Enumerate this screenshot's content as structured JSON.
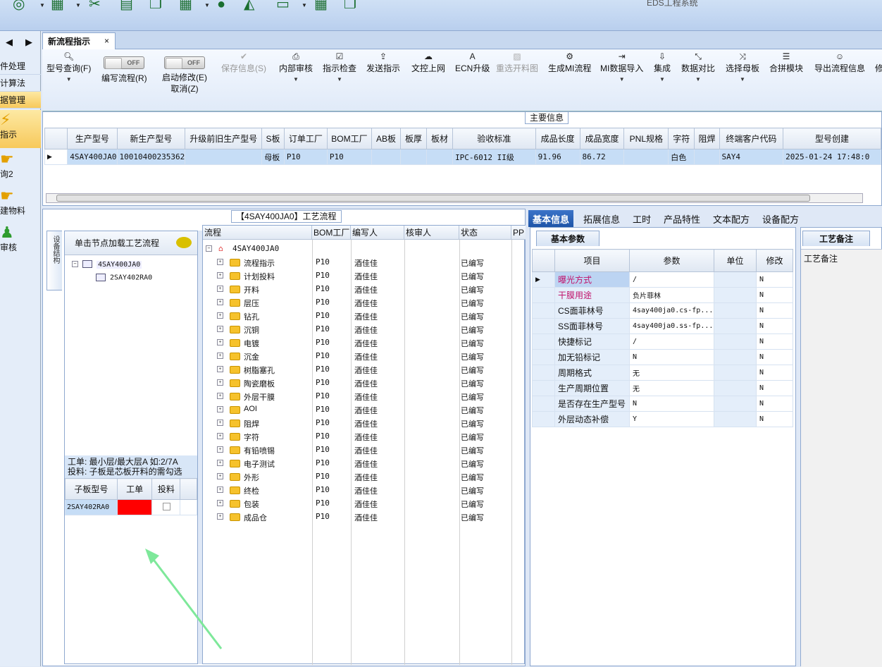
{
  "system_title": "EDS工程系统",
  "nav": {
    "items": [
      "件处理",
      "计算法",
      "据管理"
    ],
    "big_items": [
      "指示",
      "询2",
      "建物料",
      "审核"
    ]
  },
  "tab": {
    "label": "新流程指示",
    "close": "×"
  },
  "toolbar": {
    "items": [
      {
        "label": "型号查询(F)",
        "icon": "search-icon"
      },
      {
        "label": "编写流程(R)",
        "switch": "OFF"
      },
      {
        "label": "启动修改(E)",
        "label2": "取消(Z)",
        "switch": "OFF"
      },
      {
        "label": "保存信息(S)",
        "icon": "check-icon"
      },
      {
        "label": "内部审核",
        "icon": "printer-icon"
      },
      {
        "label": "指示检查",
        "icon": "checkbox-icon"
      },
      {
        "label": "发送指示",
        "icon": "upload-icon"
      },
      {
        "label": "文控上网",
        "icon": "cloud-upload-icon"
      },
      {
        "label": "ECN升级",
        "icon": "font-icon"
      },
      {
        "label": "重选开料图",
        "icon": "picture-icon"
      },
      {
        "label": "生成MI流程",
        "icon": "gears-icon"
      },
      {
        "label": "MI数据导入",
        "icon": "sign-in-icon"
      },
      {
        "label": "集成",
        "icon": "download-icon"
      },
      {
        "label": "数据对比",
        "icon": "compress-icon"
      },
      {
        "label": "选择母板",
        "icon": "shuffle-icon"
      },
      {
        "label": "合拼模块",
        "icon": "list-icon"
      },
      {
        "label": "导出流程信息",
        "icon": "smile-icon"
      },
      {
        "label": "修",
        "icon": ""
      }
    ]
  },
  "main_info": {
    "title": "主要信息",
    "columns": [
      "生产型号",
      "新生产型号",
      "升级前旧生产型号",
      "S板",
      "订单工厂",
      "BOM工厂",
      "AB板",
      "板厚",
      "板材",
      "验收标准",
      "成品长度",
      "成品宽度",
      "PNL规格",
      "字符",
      "阻焊",
      "终端客户代码",
      "型号创建"
    ],
    "row": [
      "4SAY400JA0",
      "10010400235362",
      "",
      "母板",
      "P10",
      "P10",
      "",
      "",
      "",
      "IPC-6012 II级",
      "91.96",
      "86.72",
      "",
      "白色",
      "",
      "SAY4",
      "2025-01-24 17:48:0"
    ]
  },
  "process": {
    "title": "【4SAY400JA0】工艺流程",
    "vertical_tab": "设备结构",
    "tree_header": "单击节点加载工艺流程",
    "tree": [
      "4SAY400JA0",
      "2SAY402RA0"
    ],
    "note1": "工单: 最小层/最大层A 如:2/7A",
    "note2": "投料: 子板是芯板开料的需勾选",
    "sub_columns": [
      "子板型号",
      "工单",
      "投料"
    ],
    "sub_row": {
      "model": "2SAY402RA0",
      "color": "#ff0000"
    },
    "grid_columns": [
      "流程",
      "BOM工厂",
      "编写人",
      "核审人",
      "状态",
      "PP"
    ],
    "root": "4SAY400JA0",
    "steps": [
      "流程指示",
      "计划投料",
      "开料",
      "层压",
      "钻孔",
      "沉铜",
      "电镀",
      "沉金",
      "树脂塞孔",
      "陶瓷磨板",
      "外层干膜",
      "AOI",
      "阻焊",
      "字符",
      "有铅喷锡",
      "电子测试",
      "外形",
      "终检",
      "包装",
      "成品仓"
    ],
    "factory": "P10",
    "writer": "酒佳佳",
    "status": "已编写"
  },
  "right": {
    "tabs": [
      "基本信息",
      "拓展信息",
      "工时",
      "产品特性",
      "文本配方",
      "设备配方"
    ],
    "sub_tab": "基本参数",
    "columns": [
      "项目",
      "参数",
      "单位",
      "修改"
    ],
    "rows": [
      [
        "曝光方式",
        "/",
        "",
        "N"
      ],
      [
        "干膜用途",
        "负片菲林",
        "",
        "N"
      ],
      [
        "CS面菲林号",
        "4say400ja0.cs-fp...",
        "",
        "N"
      ],
      [
        "SS面菲林号",
        "4say400ja0.ss-fp...",
        "",
        "N"
      ],
      [
        "快捷标记",
        "/",
        "",
        "N"
      ],
      [
        "加无铅标记",
        "N",
        "",
        "N"
      ],
      [
        "周期格式",
        "无",
        "",
        "N"
      ],
      [
        "生产周期位置",
        "无",
        "",
        "N"
      ],
      [
        "是否存在生产型号",
        "N",
        "",
        "N"
      ],
      [
        "外层动态补偿",
        "Y",
        "",
        "N"
      ]
    ]
  },
  "note_panel": {
    "tab": "工艺备注",
    "label": "工艺备注"
  },
  "colors": {
    "accent": "#1f55a8",
    "pink_text": "#c0136b",
    "arrow": "#7ee89a"
  }
}
